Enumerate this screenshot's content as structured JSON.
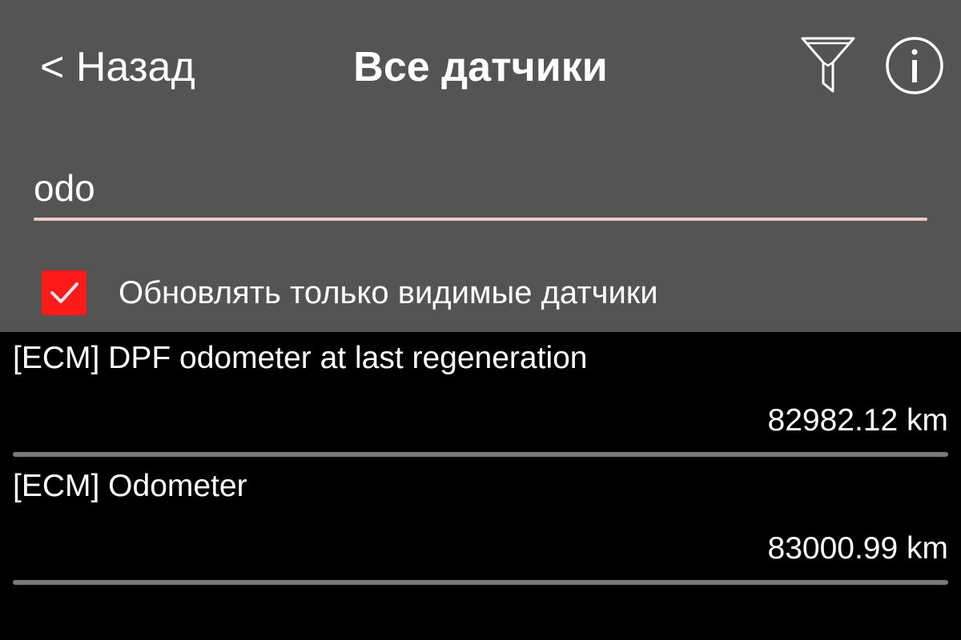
{
  "header": {
    "back_label": "< Назад",
    "title": "Все датчики",
    "filter_icon": "filter-funnel-icon",
    "info_icon": "info-circle-icon"
  },
  "search": {
    "value": "odo",
    "underline_color": "#f0c8c8"
  },
  "checkbox": {
    "label": "Обновлять только видимые датчики",
    "checked": true,
    "color": "#ff1a1a"
  },
  "sensors": [
    {
      "name": "[ECM] DPF odometer at last regeneration",
      "value": "82982.12 km"
    },
    {
      "name": "[ECM] Odometer",
      "value": "83000.99 km"
    }
  ],
  "colors": {
    "panel_bg": "#545454",
    "list_bg": "#000000",
    "text": "#ffffff",
    "divider": "#7a7a7a"
  }
}
